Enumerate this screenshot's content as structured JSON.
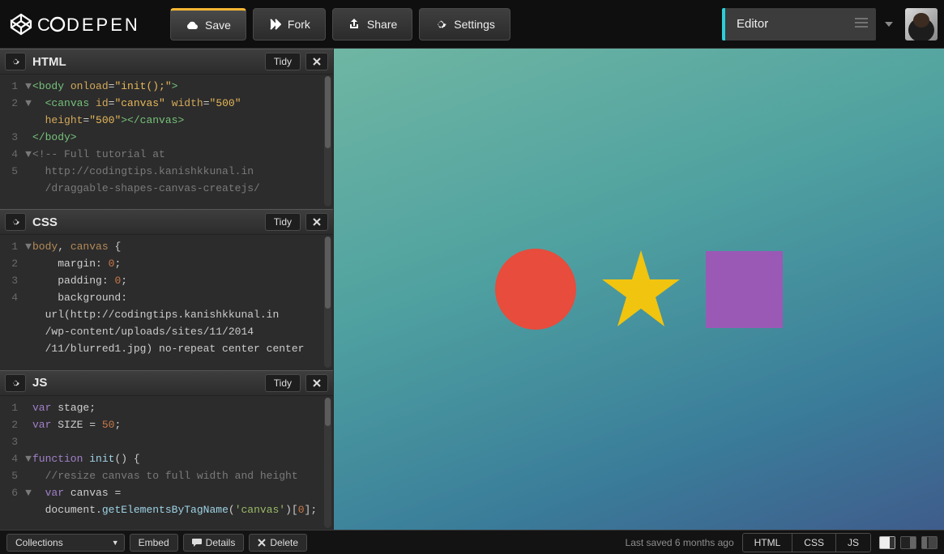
{
  "topbar": {
    "save_label": "Save",
    "fork_label": "Fork",
    "share_label": "Share",
    "settings_label": "Settings",
    "view_tab_label": "Editor"
  },
  "panes": {
    "html": {
      "title": "HTML",
      "tidy_label": "Tidy",
      "lines": [
        {
          "n": "1",
          "fold": "▼",
          "html": "<span class='c-tag'>&lt;body</span> <span class='c-attr'>onload</span>=<span class='c-str'>\"init();\"</span><span class='c-tag'>&gt;</span>"
        },
        {
          "n": "2",
          "fold": "▼",
          "html": "  <span class='c-tag'>&lt;canvas</span> <span class='c-attr'>id</span>=<span class='c-str'>\"canvas\"</span> <span class='c-attr'>width</span>=<span class='c-str'>\"500\"</span>"
        },
        {
          "n": "",
          "fold": "",
          "html": "  <span class='c-attr'>height</span>=<span class='c-str'>\"500\"</span><span class='c-tag'>&gt;&lt;/canvas&gt;</span>"
        },
        {
          "n": "3",
          "fold": "",
          "html": "<span class='c-tag'>&lt;/body&gt;</span>"
        },
        {
          "n": "4",
          "fold": "▼",
          "html": "<span class='c-comm'>&lt;!-- Full tutorial at</span>"
        },
        {
          "n": "5",
          "fold": "",
          "html": "  <span class='c-comm'>http://codingtips.kanishkkunal.in</span>"
        },
        {
          "n": "",
          "fold": "",
          "html": "  <span class='c-comm'>/draggable-shapes-canvas-createjs/</span>"
        }
      ]
    },
    "css": {
      "title": "CSS",
      "tidy_label": "Tidy",
      "lines": [
        {
          "n": "1",
          "fold": "▼",
          "html": "<span class='c-sel'>body</span>, <span class='c-sel'>canvas</span> {"
        },
        {
          "n": "2",
          "fold": "",
          "html": "    <span class='c-prop'>margin</span>: <span class='c-num'>0</span>;"
        },
        {
          "n": "3",
          "fold": "",
          "html": "    <span class='c-prop'>padding</span>: <span class='c-num'>0</span>;"
        },
        {
          "n": "4",
          "fold": "",
          "html": "    <span class='c-prop'>background</span>:"
        },
        {
          "n": "",
          "fold": "",
          "html": "  url(http://codingtips.kanishkkunal.in"
        },
        {
          "n": "",
          "fold": "",
          "html": "  /wp-content/uploads/sites/11/2014"
        },
        {
          "n": "",
          "fold": "",
          "html": "  /11/blurred1.jpg) no-repeat center center"
        }
      ]
    },
    "js": {
      "title": "JS",
      "tidy_label": "Tidy",
      "lines": [
        {
          "n": "1",
          "fold": "",
          "html": "<span class='c-kw'>var</span> <span class='c-ident'>stage</span>;"
        },
        {
          "n": "2",
          "fold": "",
          "html": "<span class='c-kw'>var</span> <span class='c-ident'>SIZE</span> = <span class='c-num'>50</span>;"
        },
        {
          "n": "3",
          "fold": "",
          "html": ""
        },
        {
          "n": "4",
          "fold": "▼",
          "html": "<span class='c-kw'>function</span> <span class='c-fn'>init</span>() {"
        },
        {
          "n": "5",
          "fold": "",
          "html": "  <span class='c-comm'>//resize canvas to full width and height</span>"
        },
        {
          "n": "6",
          "fold": "▼",
          "html": "  <span class='c-kw'>var</span> <span class='c-ident'>canvas</span> ="
        },
        {
          "n": "",
          "fold": "",
          "html": "  <span class='c-ident'>document</span>.<span class='c-fn'>getElementsByTagName</span>(<span class='c-js-str'>'canvas'</span>)[<span class='c-num'>0</span>];"
        }
      ]
    }
  },
  "preview": {
    "shapes": {
      "circle_color": "#e74c3c",
      "star_color": "#f1c40f",
      "square_color": "#9b59b6"
    }
  },
  "bottombar": {
    "collections_label": "Collections",
    "embed_label": "Embed",
    "details_label": "Details",
    "delete_label": "Delete",
    "status_text": "Last saved 6 months ago",
    "seg_html": "HTML",
    "seg_css": "CSS",
    "seg_js": "JS"
  }
}
